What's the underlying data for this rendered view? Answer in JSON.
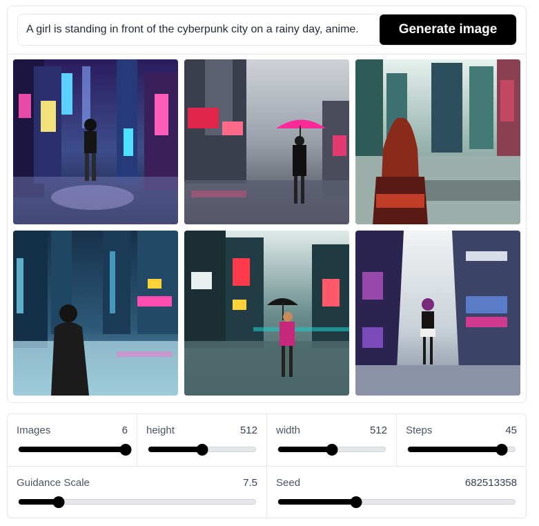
{
  "prompt": {
    "value": "A girl is standing in front of the cyberpunk city on a rainy day, anime.",
    "button_label": "Generate image"
  },
  "gallery": [
    {
      "name": "generated-image-1"
    },
    {
      "name": "generated-image-2"
    },
    {
      "name": "generated-image-3"
    },
    {
      "name": "generated-image-4"
    },
    {
      "name": "generated-image-5"
    },
    {
      "name": "generated-image-6"
    }
  ],
  "controls": {
    "images": {
      "label": "Images",
      "value": "6",
      "fraction": 1.0
    },
    "height": {
      "label": "height",
      "value": "512",
      "fraction": 0.5
    },
    "width": {
      "label": "width",
      "value": "512",
      "fraction": 0.5
    },
    "steps": {
      "label": "Steps",
      "value": "45",
      "fraction": 0.88
    },
    "guidance": {
      "label": "Guidance Scale",
      "value": "7.5",
      "fraction": 0.17
    },
    "seed": {
      "label": "Seed",
      "value": "682513358",
      "fraction": 0.33
    }
  },
  "colors": {
    "accent": "#000000",
    "track": "#e5e7eb",
    "border": "#e5e7eb"
  }
}
